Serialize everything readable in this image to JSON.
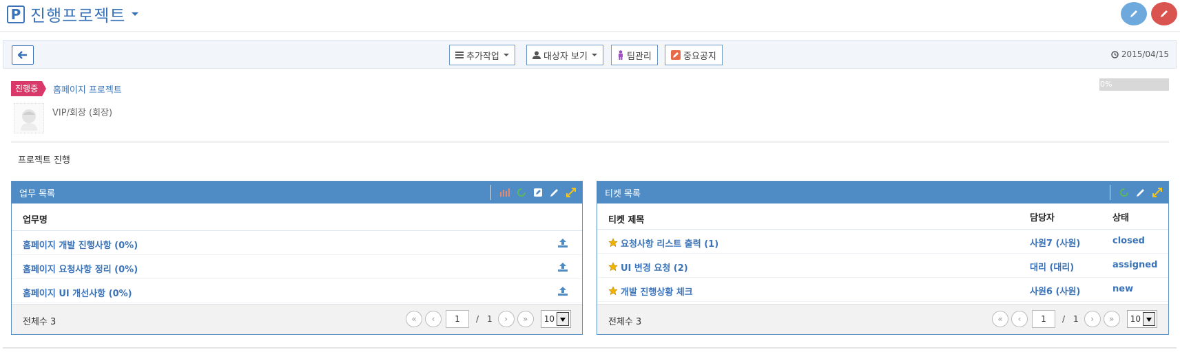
{
  "header": {
    "logo_letter": "P",
    "title": "진행프로젝트"
  },
  "toolbar": {
    "extra_work_label": "추가작업",
    "view_target_label": "대상자 보기",
    "team_mgmt_label": "팀관리",
    "notice_label": "중요공지",
    "date": "2015/04/15"
  },
  "project": {
    "status": "진행중",
    "name": "홈페이지 프로젝트",
    "owner": "VIP/회장 (회장)",
    "progress_label": "0%",
    "progress_value": 0
  },
  "section_title": "프로젝트 진행",
  "task_panel": {
    "title": "업무 목록",
    "column_name": "업무명",
    "rows": [
      {
        "name": "홈페이지 개발 진행사항 (0%)"
      },
      {
        "name": "홈페이지 요청사항 정리 (0%)"
      },
      {
        "name": "홈페이지 UI 개선사항 (0%)"
      }
    ],
    "total_label": "전체수 3",
    "page": "1",
    "page_total": "1",
    "page_size": "10"
  },
  "ticket_panel": {
    "title": "티켓 목록",
    "column_title": "티켓 제목",
    "column_assignee": "담당자",
    "column_status": "상태",
    "rows": [
      {
        "title": "요청사항 리스트 출력 (1)",
        "assignee": "사원7 (사원)",
        "status": "closed"
      },
      {
        "title": "UI 변경 요청 (2)",
        "assignee": "대리 (대리)",
        "status": "assigned"
      },
      {
        "title": "개발 진행상황 체크",
        "assignee": "사원6 (사원)",
        "status": "new"
      }
    ],
    "total_label": "전체수 3",
    "page": "1",
    "page_total": "1",
    "page_size": "10"
  },
  "colors": {
    "brand": "#3a73b7",
    "panel_header": "#4f8bc4",
    "status_tag": "#d9386a",
    "edit_blue": "#6ea9dd",
    "edit_red": "#d9534f"
  }
}
